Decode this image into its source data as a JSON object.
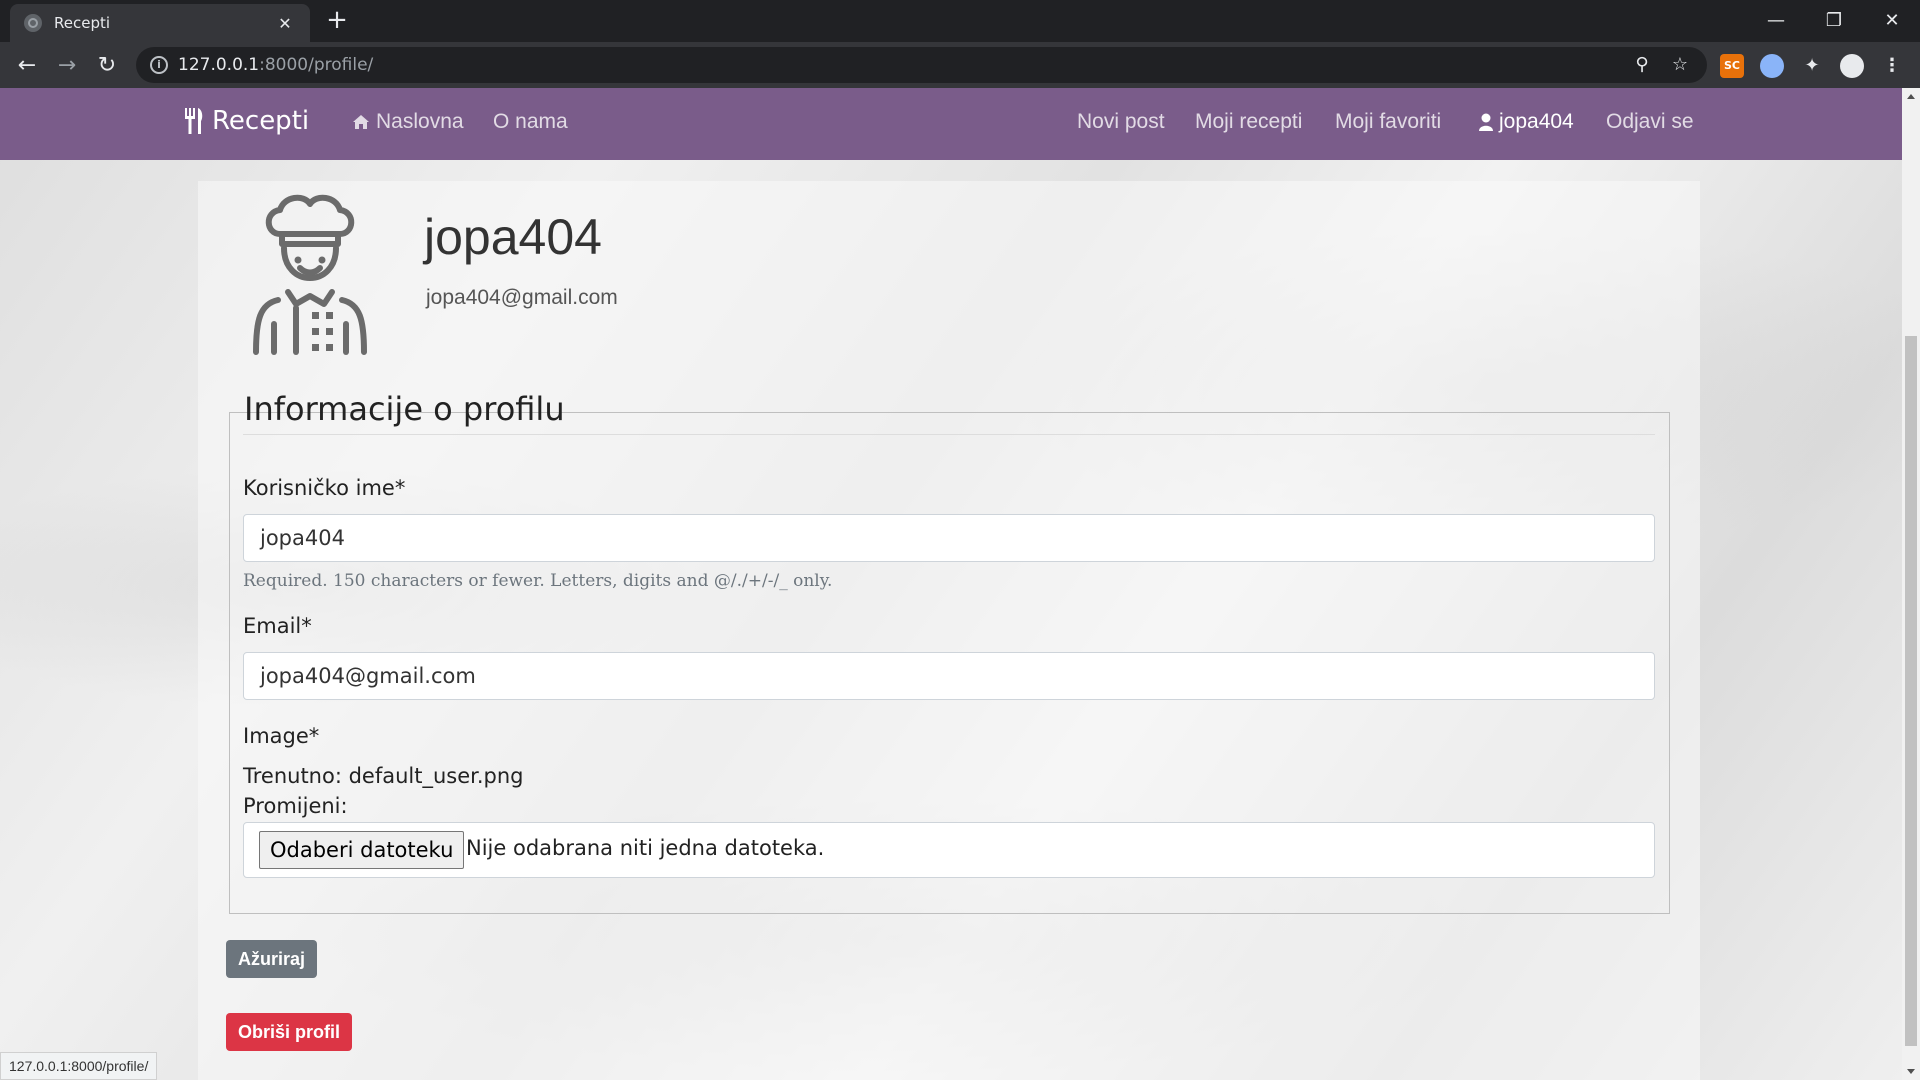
{
  "browser": {
    "tab_title": "Recepti",
    "tab_close": "✕",
    "new_tab": "+",
    "url_host": "127.0.0.1",
    "url_path": ":8000/profile/",
    "status_url": "127.0.0.1:8000/profile/",
    "ext_sc_label": "SC"
  },
  "navbar": {
    "brand": "Recepti",
    "home": "Naslovna",
    "about": "O nama",
    "new_post": "Novi post",
    "my_recipes": "Moji recepti",
    "my_favorites": "Moji favoriti",
    "user": "jopa404",
    "logout": "Odjavi se",
    "bg_color": "#7a5c8a"
  },
  "profile": {
    "username": "jopa404",
    "email": "jopa404@gmail.com"
  },
  "form": {
    "legend": "Informacije o profilu",
    "username_label": "Korisničko ime*",
    "username_value": "jopa404",
    "username_help": "Required. 150 characters or fewer. Letters, digits and @/./+/-/_ only.",
    "email_label": "Email*",
    "email_value": "jopa404@gmail.com",
    "image_label": "Image*",
    "image_current": "Trenutno: default_user.png",
    "image_change": "Promijeni:",
    "file_button": "Odaberi datoteku",
    "file_status": "Nije odabrana niti jedna datoteka.",
    "update_button": "Ažuriraj",
    "delete_button": "Obriši profil",
    "update_color": "#6c757d",
    "delete_color": "#dc3545"
  }
}
